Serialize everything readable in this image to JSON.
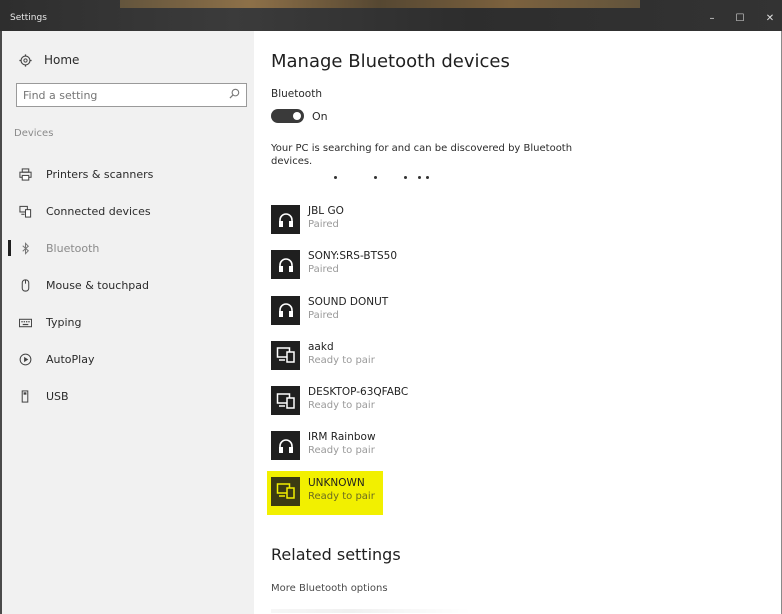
{
  "window": {
    "title": "Settings",
    "controls": {
      "minimize": "–",
      "maximize": "☐",
      "close": "✕"
    }
  },
  "sidebar": {
    "home_label": "Home",
    "search_placeholder": "Find a setting",
    "section_label": "Devices",
    "items": [
      {
        "label": "Printers & scanners",
        "icon": "printer-icon"
      },
      {
        "label": "Connected devices",
        "icon": "connected-devices-icon"
      },
      {
        "label": "Bluetooth",
        "icon": "bluetooth-icon",
        "active": true
      },
      {
        "label": "Mouse & touchpad",
        "icon": "mouse-icon"
      },
      {
        "label": "Typing",
        "icon": "keyboard-icon"
      },
      {
        "label": "AutoPlay",
        "icon": "autoplay-icon"
      },
      {
        "label": "USB",
        "icon": "usb-icon"
      }
    ]
  },
  "main": {
    "title": "Manage Bluetooth devices",
    "bluetooth_label": "Bluetooth",
    "toggle_state": "On",
    "searching_text": "Your PC is searching for and can be discovered by Bluetooth devices.",
    "devices": [
      {
        "name": "JBL GO",
        "status": "Paired",
        "icon": "headphones-icon"
      },
      {
        "name": "SONY:SRS-BTS50",
        "status": "Paired",
        "icon": "headphones-icon"
      },
      {
        "name": "SOUND DONUT",
        "status": "Paired",
        "icon": "headphones-icon"
      },
      {
        "name": "aakd",
        "status": "Ready to pair",
        "icon": "devices-icon"
      },
      {
        "name": "DESKTOP-63QFABC",
        "status": "Ready to pair",
        "icon": "devices-icon"
      },
      {
        "name": "IRM Rainbow",
        "status": "Ready to pair",
        "icon": "headphones-icon"
      },
      {
        "name": "UNKNOWN",
        "status": "Ready to pair",
        "icon": "devices-icon",
        "highlighted": true
      }
    ],
    "related_title": "Related settings",
    "related_link": "More Bluetooth options"
  },
  "colors": {
    "highlight": "#f2f000",
    "sidebar_bg": "#f1f1f1",
    "titlebar": "#2e2e2e",
    "toggle_on": "#3a3a3a"
  }
}
